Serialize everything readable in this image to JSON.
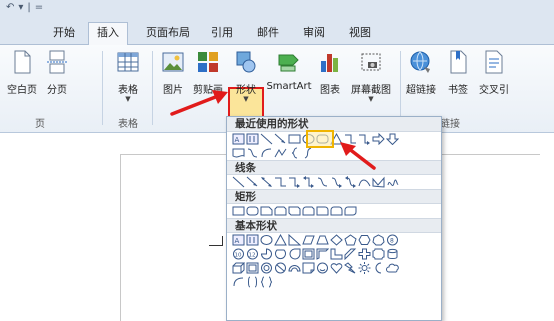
{
  "quick_access": {
    "items": [
      "↶",
      "▾",
      "|",
      "="
    ]
  },
  "tabs": [
    {
      "label": "开始",
      "active": false
    },
    {
      "label": "插入",
      "active": true
    },
    {
      "label": "页面布局",
      "active": false
    },
    {
      "label": "引用",
      "active": false
    },
    {
      "label": "邮件",
      "active": false
    },
    {
      "label": "审阅",
      "active": false
    },
    {
      "label": "视图",
      "active": false
    }
  ],
  "ribbon": {
    "buttons": [
      {
        "label": "空白页",
        "icon": "blank-page-icon"
      },
      {
        "label": "分页",
        "icon": "page-break-icon"
      },
      {
        "label": "表格",
        "icon": "table-icon"
      },
      {
        "label": "图片",
        "icon": "picture-icon"
      },
      {
        "label": "剪贴画",
        "icon": "clip-art-icon"
      },
      {
        "label": "形状",
        "icon": "shapes-icon"
      },
      {
        "label": "SmartArt",
        "icon": "smartart-icon"
      },
      {
        "label": "图表",
        "icon": "chart-icon"
      },
      {
        "label": "屏幕截图",
        "icon": "screenshot-icon"
      },
      {
        "label": "超链接",
        "icon": "hyperlink-icon"
      },
      {
        "label": "书签",
        "icon": "bookmark-icon"
      },
      {
        "label": "交叉引",
        "icon": "cross-reference-icon"
      }
    ],
    "groups": [
      "页",
      "表格",
      "链接"
    ]
  },
  "shape_menu": {
    "sections": {
      "recent": "最近使用的形状",
      "lines": "线条",
      "rectangles": "矩形",
      "basic": "基本形状"
    }
  },
  "colors": {
    "highlight_red": "#e11b1b",
    "oval_highlight": "#f0b400",
    "shape_stroke": "#3a5a8c",
    "tab_bar": "#dde6f1"
  }
}
